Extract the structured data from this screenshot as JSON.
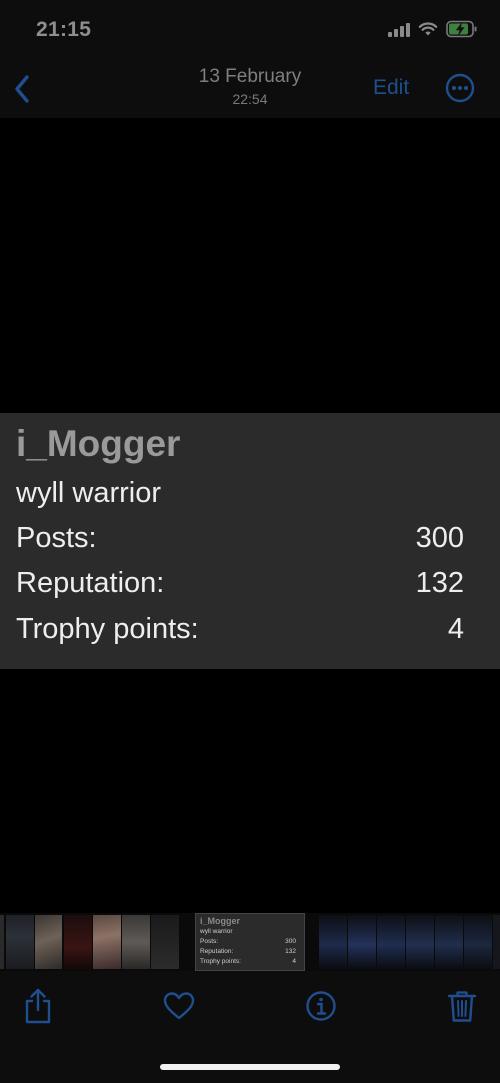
{
  "status_bar": {
    "time": "21:15",
    "icons": [
      "cellular-signal-icon",
      "wifi-icon",
      "battery-charging-icon"
    ]
  },
  "nav": {
    "title": "13 February",
    "subtitle": "22:54",
    "edit_label": "Edit",
    "back_icon": "chevron-left-icon",
    "more_icon": "ellipsis-circle-icon"
  },
  "photo": {
    "name": "i_Mogger",
    "title": "wyll warrior",
    "stats": [
      {
        "label": "Posts:",
        "value": "300"
      },
      {
        "label": "Reputation:",
        "value": "132"
      },
      {
        "label": "Trophy points:",
        "value": "4"
      }
    ]
  },
  "thumbnail": {
    "name": "i_Mogger",
    "title": "wyll warrior",
    "stats": [
      {
        "label": "Posts:",
        "value": "300"
      },
      {
        "label": "Reputation:",
        "value": "132"
      },
      {
        "label": "Trophy points:",
        "value": "4"
      }
    ]
  },
  "toolbar": {
    "icons": [
      "share-icon",
      "heart-icon",
      "info-icon",
      "trash-icon"
    ]
  },
  "colors": {
    "accent": "#1f4f8f",
    "card_bg": "#2b2b2b",
    "background": "#000000"
  }
}
